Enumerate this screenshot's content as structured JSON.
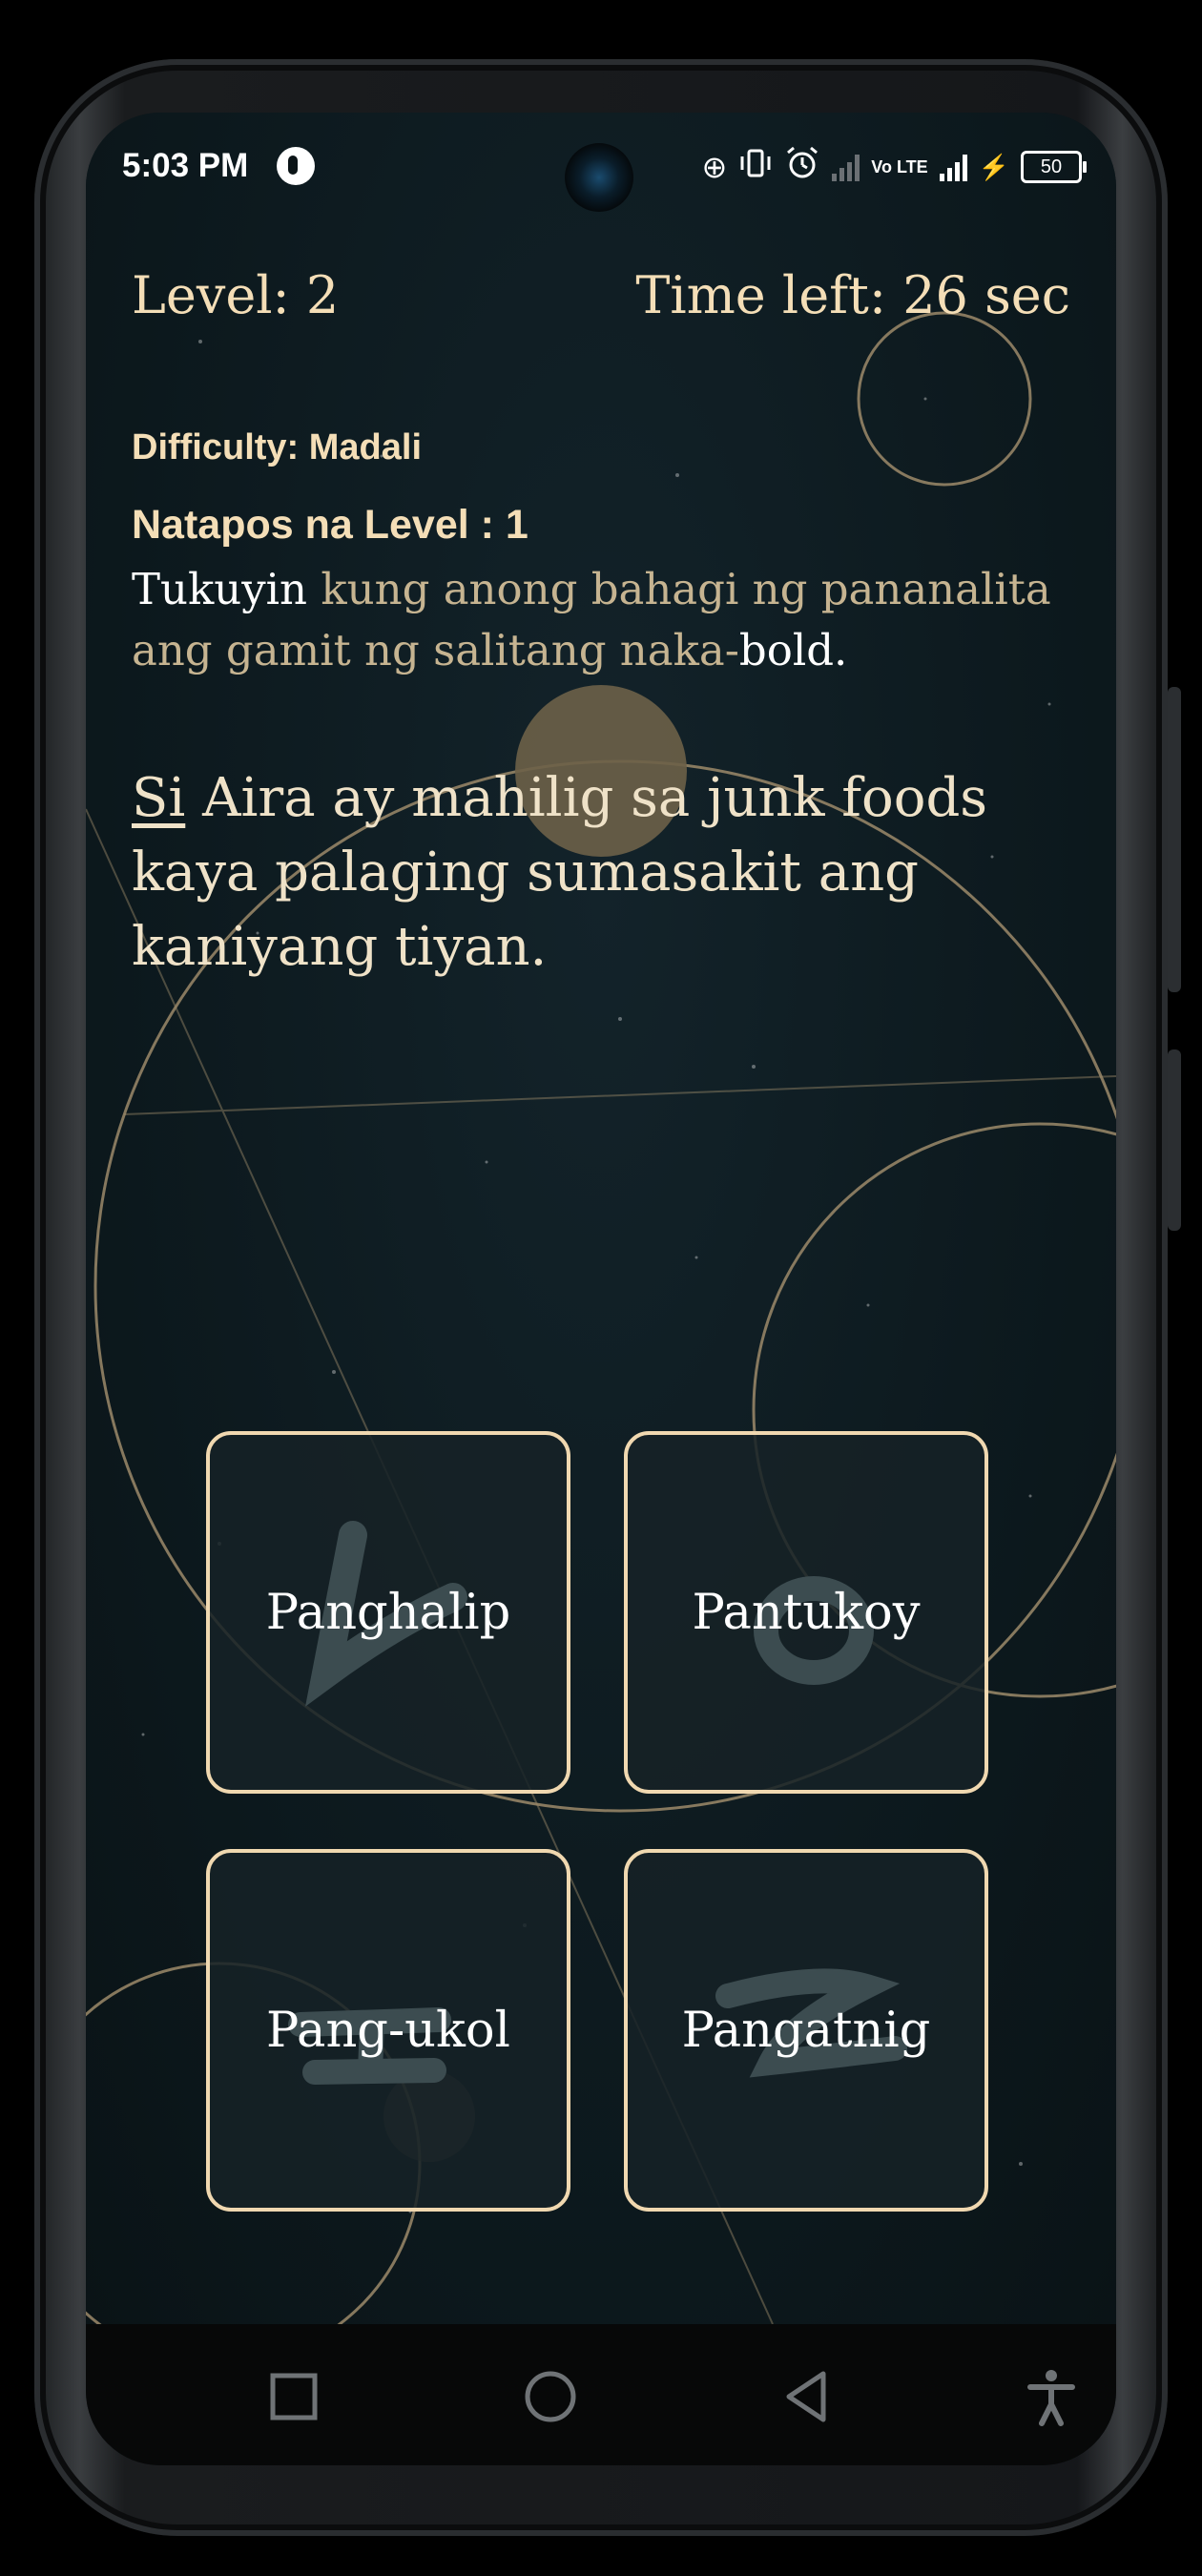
{
  "status_bar": {
    "time": "5:03 PM",
    "network_label": "Vo LTE",
    "battery": "50",
    "icons": [
      "app-icon",
      "data-saver-icon",
      "vibrate-icon",
      "alarm-icon",
      "signal-icon",
      "charging-icon",
      "battery-icon"
    ]
  },
  "game": {
    "level": "Level: 2",
    "time_left": "Time left: 26 sec",
    "difficulty": "Difficulty: Madali",
    "completed_levels": "Natapos na Level : 1",
    "instruction": {
      "lead": "Tukuyin",
      "middle": " kung anong bahagi ng pananalita ang gamit ng salitang naka-",
      "tail": "bold."
    },
    "sentence": {
      "bold_word": "Si",
      "rest": " Aira ay mahilig sa junk foods kaya palaging sumasakit ang kaniyang tiyan."
    },
    "answers": [
      "Panghalip",
      "Pantukoy",
      "Pang-ukol",
      "Pangatnig"
    ]
  },
  "nav_bar": {
    "buttons": [
      "recents-icon",
      "home-icon",
      "back-icon",
      "accessibility-icon"
    ]
  },
  "colors": {
    "accent": "#f4deb7",
    "button_border": "#f0d8b0",
    "background": "#0b1417"
  }
}
